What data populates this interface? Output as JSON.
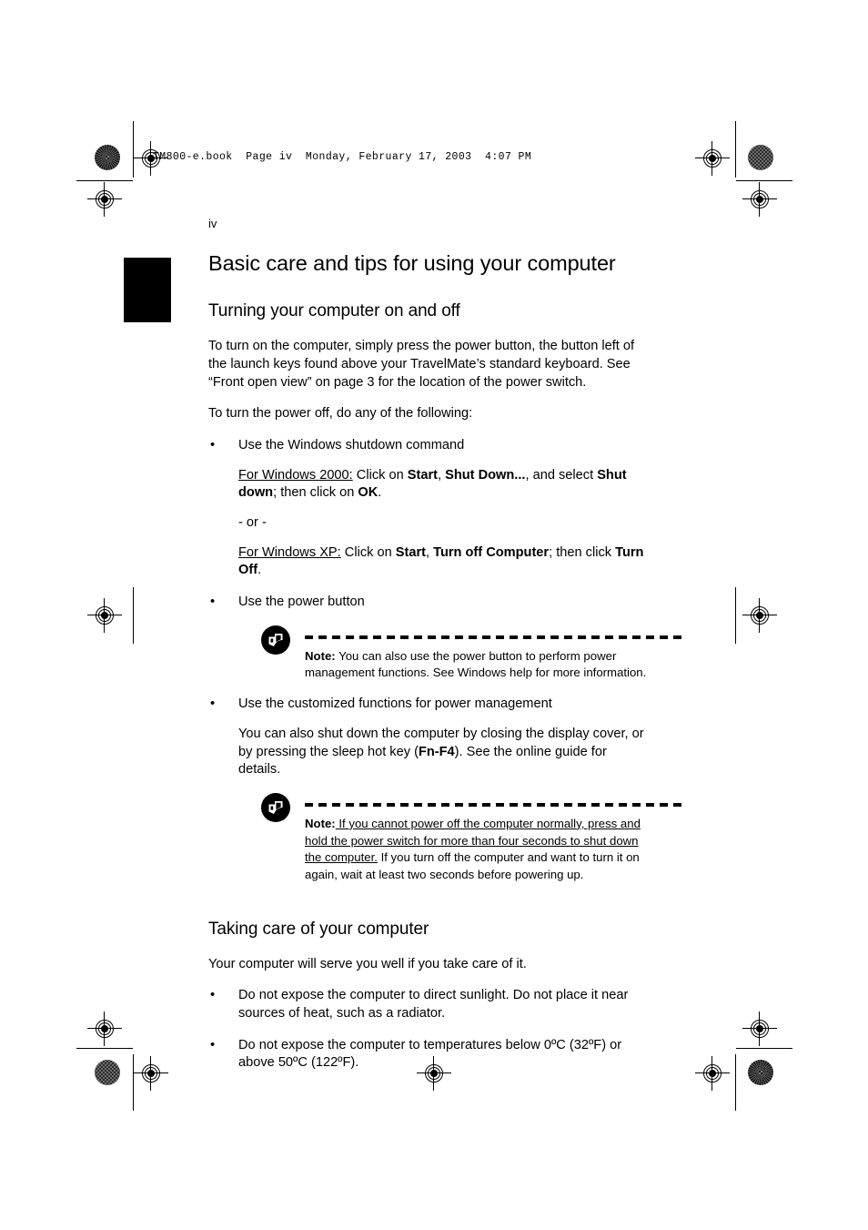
{
  "page": {
    "file_header": "TM800-e.book  Page iv  Monday, February 17, 2003  4:07 PM",
    "folio": "iv"
  },
  "content": {
    "title": "Basic care and tips for using your computer",
    "section_one": {
      "heading": "Turning your computer on and off",
      "intro_paragraph": "To turn on the computer, simply press the power button, the button left of the launch keys found above your TravelMate’s standard keyboard. See “Front open view” on page 3 for the location of the power switch.",
      "lead_in": "To turn the power off, do any of the following:",
      "bullets": [
        {
          "label": "Use the Windows shutdown command",
          "win2000": {
            "prefix_underlined": "For Windows 2000:",
            "t1": " Click on ",
            "b1": "Start",
            "t2": ", ",
            "b2": "Shut Down...",
            "t3": ", and select ",
            "b3": "Shut down",
            "t4": "; then click on ",
            "b4": "OK",
            "t5": "."
          },
          "or_separator": "- or -",
          "winxp": {
            "prefix_underlined": "For Windows XP:",
            "t1": " Click on ",
            "b1": "Start",
            "t2": ", ",
            "b2": "Turn off Computer",
            "t3": "; then click ",
            "b3": "Turn Off",
            "t4": "."
          }
        },
        {
          "label": "Use the power button",
          "note": {
            "label": "Note:",
            "body": " You can also use the power button to perform power management functions. See Windows help for more information."
          }
        },
        {
          "label": "Use the customized functions for power management",
          "detail": {
            "t1": "You can also shut down the computer by closing the display cover, or by pressing the sleep hot key (",
            "b1": "Fn-F4",
            "t2": "). See the online guide for details."
          },
          "note": {
            "label": "Note:",
            "underlined": " If you cannot power off the computer normally, press and hold the power switch for more than four seconds to shut down the computer.",
            "rest": " If you turn off the computer and want to turn it on again, wait at least two seconds before powering up."
          }
        }
      ]
    },
    "section_two": {
      "heading": "Taking care of your computer",
      "intro_paragraph": "Your computer will serve you well if you take care of it.",
      "bullets": [
        "Do not expose the computer to direct sunlight. Do not place it near sources of heat, such as a radiator.",
        "Do not expose the computer to temperatures below 0ºC (32ºF) or above 50ºC (122ºF)."
      ]
    }
  },
  "icons": {
    "note_icon": "acer-note-icon",
    "registration_target": "registration-target-icon",
    "halftone_patch": "halftone-density-patch-icon",
    "noise_patch": "noise-density-patch-icon"
  }
}
